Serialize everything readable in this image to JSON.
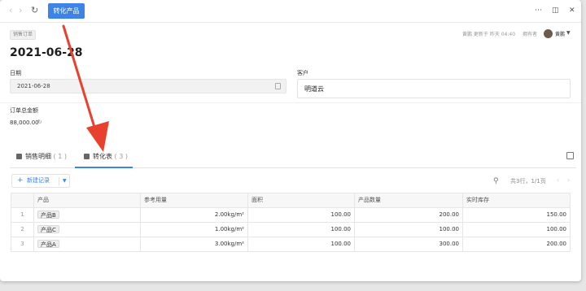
{
  "toolbar": {
    "back_icon": "chevron-left-icon",
    "forward_icon": "chevron-right-icon",
    "reload_icon": "reload-icon",
    "convert_label": "转化产品",
    "more_icon": "more-icon",
    "layout_icon": "layout-icon",
    "close_icon": "close-icon"
  },
  "header": {
    "tag": "销售订单",
    "meta": "黄鹏 更新于 昨天 04:40",
    "owner_label": "拥有者",
    "owner_name": "黄鹏",
    "title": "2021-06-28"
  },
  "fields": {
    "date_label": "日期",
    "date_value": "2021-06-28",
    "customer_label": "客户",
    "customer_value": "明道云",
    "amount_label": "订单总金额",
    "amount_value": "88,000.00"
  },
  "tabs": [
    {
      "label": "销售明细",
      "count": "( 1 )"
    },
    {
      "label": "转化表",
      "count": "( 3 )"
    }
  ],
  "list": {
    "new_label": "新建记录",
    "pager": "共3行，1/1页"
  },
  "table": {
    "headers": [
      "产品",
      "参考用量",
      "面积",
      "产品数量",
      "实时库存"
    ],
    "rows": [
      {
        "idx": "1",
        "product": "产品B",
        "usage": "2.00kg/m²",
        "area": "100.00",
        "qty": "200.00",
        "stock": "150.00"
      },
      {
        "idx": "2",
        "product": "产品C",
        "usage": "1.00kg/m²",
        "area": "100.00",
        "qty": "100.00",
        "stock": "100.00"
      },
      {
        "idx": "3",
        "product": "产品A",
        "usage": "3.00kg/m²",
        "area": "100.00",
        "qty": "300.00",
        "stock": "200.00"
      }
    ]
  },
  "colors": {
    "accent": "#3d84e6",
    "annotation_arrow": "#e8412e"
  }
}
